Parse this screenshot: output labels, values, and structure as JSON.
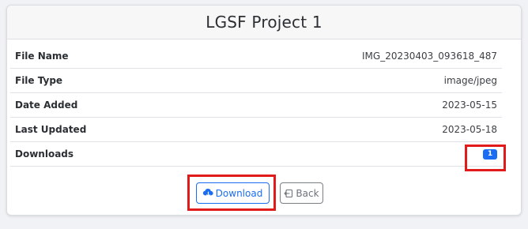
{
  "header": {
    "title": "LGSF Project 1"
  },
  "details": [
    {
      "label": "File Name",
      "value": "IMG_20230403_093618_487"
    },
    {
      "label": "File Type",
      "value": "image/jpeg"
    },
    {
      "label": "Date Added",
      "value": "2023-05-15"
    },
    {
      "label": "Last Updated",
      "value": "2023-05-18"
    },
    {
      "label": "Downloads",
      "value": "1"
    }
  ],
  "actions": {
    "download_label": "Download",
    "back_label": "Back",
    "download_icon": "cloud-download-icon",
    "back_icon": "box-arrow-left-icon"
  },
  "colors": {
    "accent": "#1b6ef3",
    "highlight": "#e11a1a",
    "secondary": "#6c737a"
  }
}
